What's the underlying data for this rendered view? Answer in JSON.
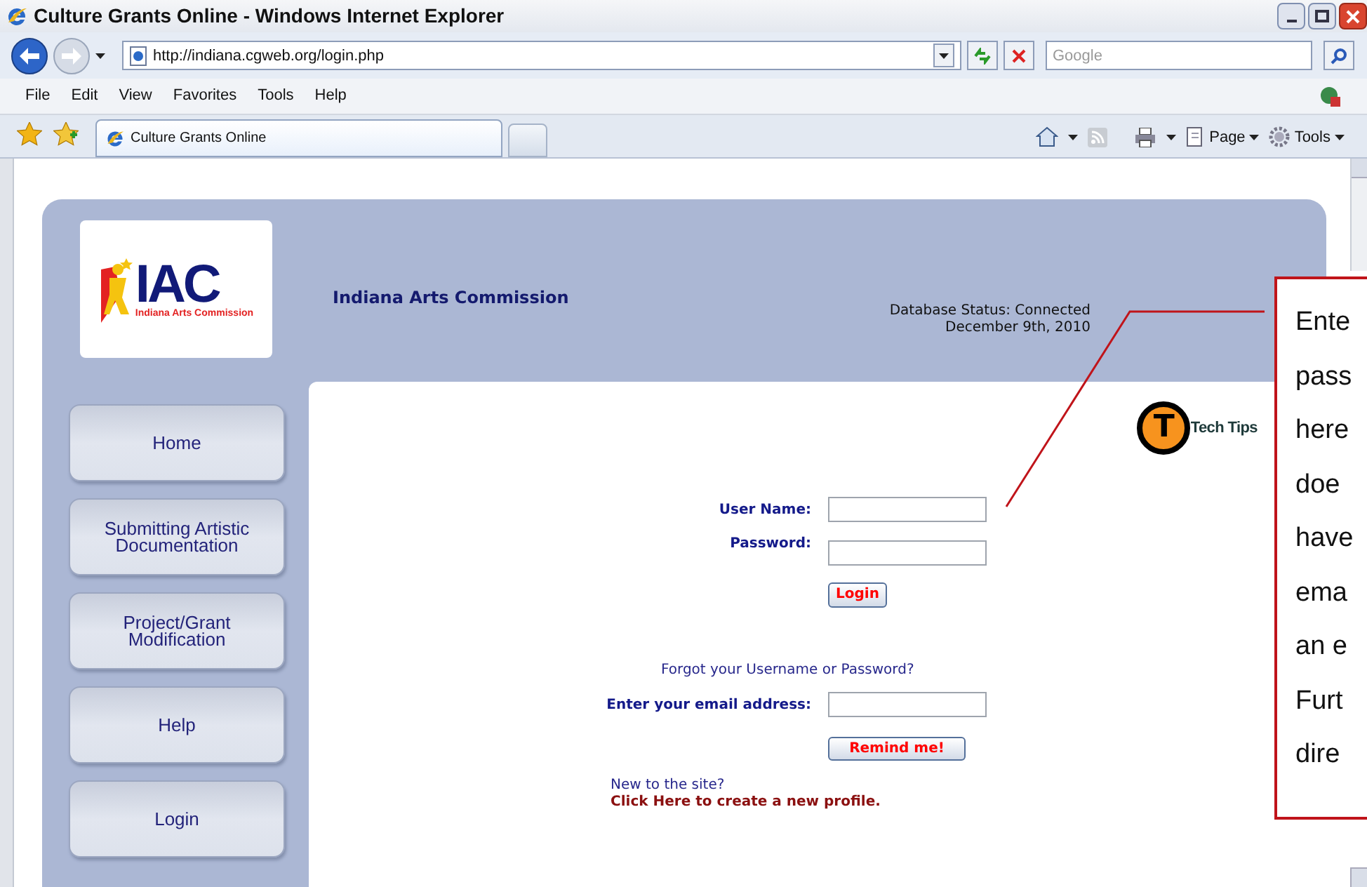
{
  "window": {
    "title": "Culture Grants Online - Windows Internet Explorer"
  },
  "address_bar": {
    "url": "http://indiana.cgweb.org/login.php",
    "search_placeholder": "Google"
  },
  "menu": [
    "File",
    "Edit",
    "View",
    "Favorites",
    "Tools",
    "Help"
  ],
  "tabs": [
    {
      "label": "Culture Grants Online",
      "selected": true
    },
    {
      "selected": false
    }
  ],
  "command_bar": [
    "Page",
    "Tools"
  ],
  "page": {
    "logo": {
      "mark": "IAC",
      "caption": "Indiana Arts Commission"
    },
    "org_title": "Indiana Arts Commission",
    "status": [
      "Database Status: Connected",
      "December 9th, 2010"
    ],
    "sidebar": [
      "Home",
      "Submitting Artistic Documentation",
      "Project/Grant Modification",
      "Help",
      "Login"
    ],
    "tech_tips": {
      "icon_letter": "T",
      "label": "Tech Tips"
    },
    "fields": [
      {
        "label": "User Name:"
      },
      {
        "label": "Password:"
      }
    ],
    "login_button": "Login",
    "forgot": "Forgot your Username or Password?",
    "email_label": "Enter your email address:",
    "remind_button": "Remind me!",
    "new_text": "New to the site?",
    "create_link": "Click Here to create a new profile."
  },
  "callout": {
    "lines": [
      "Ente",
      "pass",
      "here",
      "doe",
      "have",
      "ema",
      "an e",
      "Furt",
      "dire"
    ]
  }
}
